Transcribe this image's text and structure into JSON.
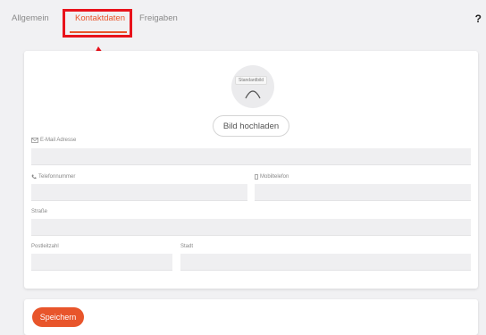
{
  "tabs": [
    {
      "label": "Allgemein"
    },
    {
      "label": "Kontaktdaten"
    },
    {
      "label": "Freigaben"
    }
  ],
  "help_label": "?",
  "profile": {
    "avatar_label": "Standardbild",
    "upload_label": "Bild hochladen"
  },
  "form": {
    "email_label": "E-Mail Adresse",
    "phone_label": "Telefonnummer",
    "mobile_label": "Mobiltelefon",
    "street_label": "Straße",
    "zip_label": "Postleitzahl",
    "city_label": "Stadt"
  },
  "actions": {
    "save_label": "Speichern"
  },
  "colors": {
    "accent": "#e8552b",
    "annotation": "#e8121b"
  }
}
